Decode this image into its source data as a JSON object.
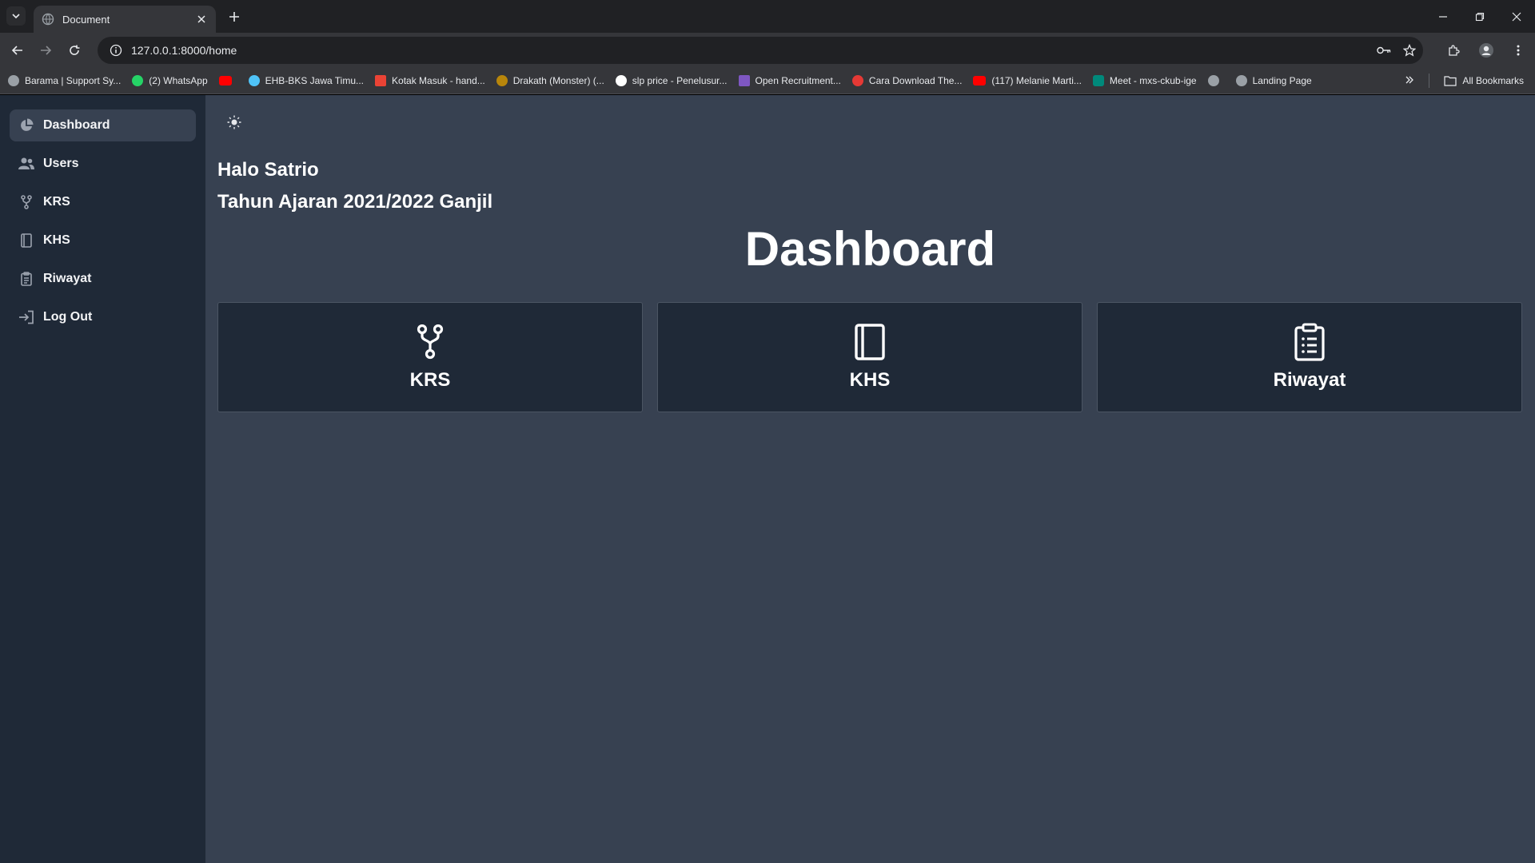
{
  "browser": {
    "tab_title": "Document",
    "url": "127.0.0.1:8000/home",
    "bookmarks": [
      {
        "label": "Barama | Support Sy...",
        "color": "#9aa0a6"
      },
      {
        "label": "(2) WhatsApp",
        "color": "#25d366"
      },
      {
        "label": "",
        "color": "#ff0000"
      },
      {
        "label": "EHB-BKS Jawa Timu...",
        "color": "#4fc3f7"
      },
      {
        "label": "Kotak Masuk - hand...",
        "color": "#ea4335"
      },
      {
        "label": "Drakath (Monster) (...",
        "color": "#b8860b"
      },
      {
        "label": "slp price - Penelusur...",
        "color": "#ffffff"
      },
      {
        "label": "Open Recruitment...",
        "color": "#7e57c2"
      },
      {
        "label": "Cara Download The...",
        "color": "#e53935"
      },
      {
        "label": "(117) Melanie Marti...",
        "color": "#ff0000"
      },
      {
        "label": "Meet - mxs-ckub-ige",
        "color": "#00897b"
      },
      {
        "label": "",
        "color": "#9aa0a6"
      },
      {
        "label": "Landing Page",
        "color": "#9aa0a6"
      }
    ],
    "all_bookmarks_label": "All Bookmarks"
  },
  "sidebar": {
    "items": [
      {
        "label": "Dashboard",
        "icon": "pie-chart-icon",
        "active": true
      },
      {
        "label": "Users",
        "icon": "users-icon",
        "active": false
      },
      {
        "label": "KRS",
        "icon": "fork-icon",
        "active": false
      },
      {
        "label": "KHS",
        "icon": "book-icon",
        "active": false
      },
      {
        "label": "Riwayat",
        "icon": "clipboard-icon",
        "active": false
      },
      {
        "label": "Log Out",
        "icon": "logout-icon",
        "active": false
      }
    ]
  },
  "main": {
    "greeting": "Halo Satrio",
    "academic_year": "Tahun Ajaran 2021/2022 Ganjil",
    "title": "Dashboard",
    "cards": [
      {
        "label": "KRS",
        "icon": "fork-icon"
      },
      {
        "label": "KHS",
        "icon": "book-icon"
      },
      {
        "label": "Riwayat",
        "icon": "clipboard-icon"
      }
    ]
  },
  "colors": {
    "sidebar_bg": "#1f2937",
    "main_bg": "#374151",
    "card_bg": "#1f2937"
  }
}
